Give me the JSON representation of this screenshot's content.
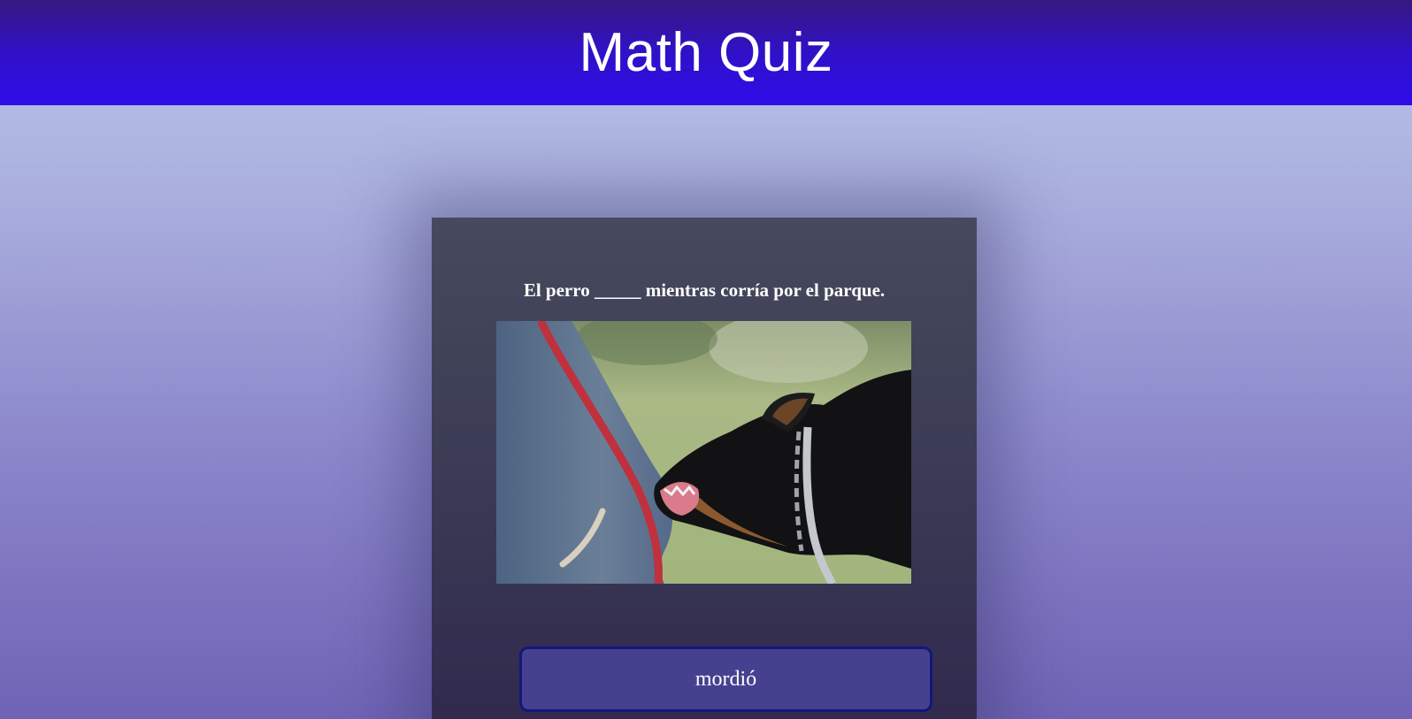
{
  "header": {
    "title": "Math Quiz"
  },
  "quiz": {
    "question": "El perro _____ mientras corría por el parque.",
    "options": [
      {
        "label": "mordió"
      }
    ]
  },
  "colors": {
    "header_bg": "#2f0cea",
    "card_bg": "#3b3b55",
    "option_bg": "#46418f",
    "option_border": "#121878",
    "text": "#ffffff"
  }
}
